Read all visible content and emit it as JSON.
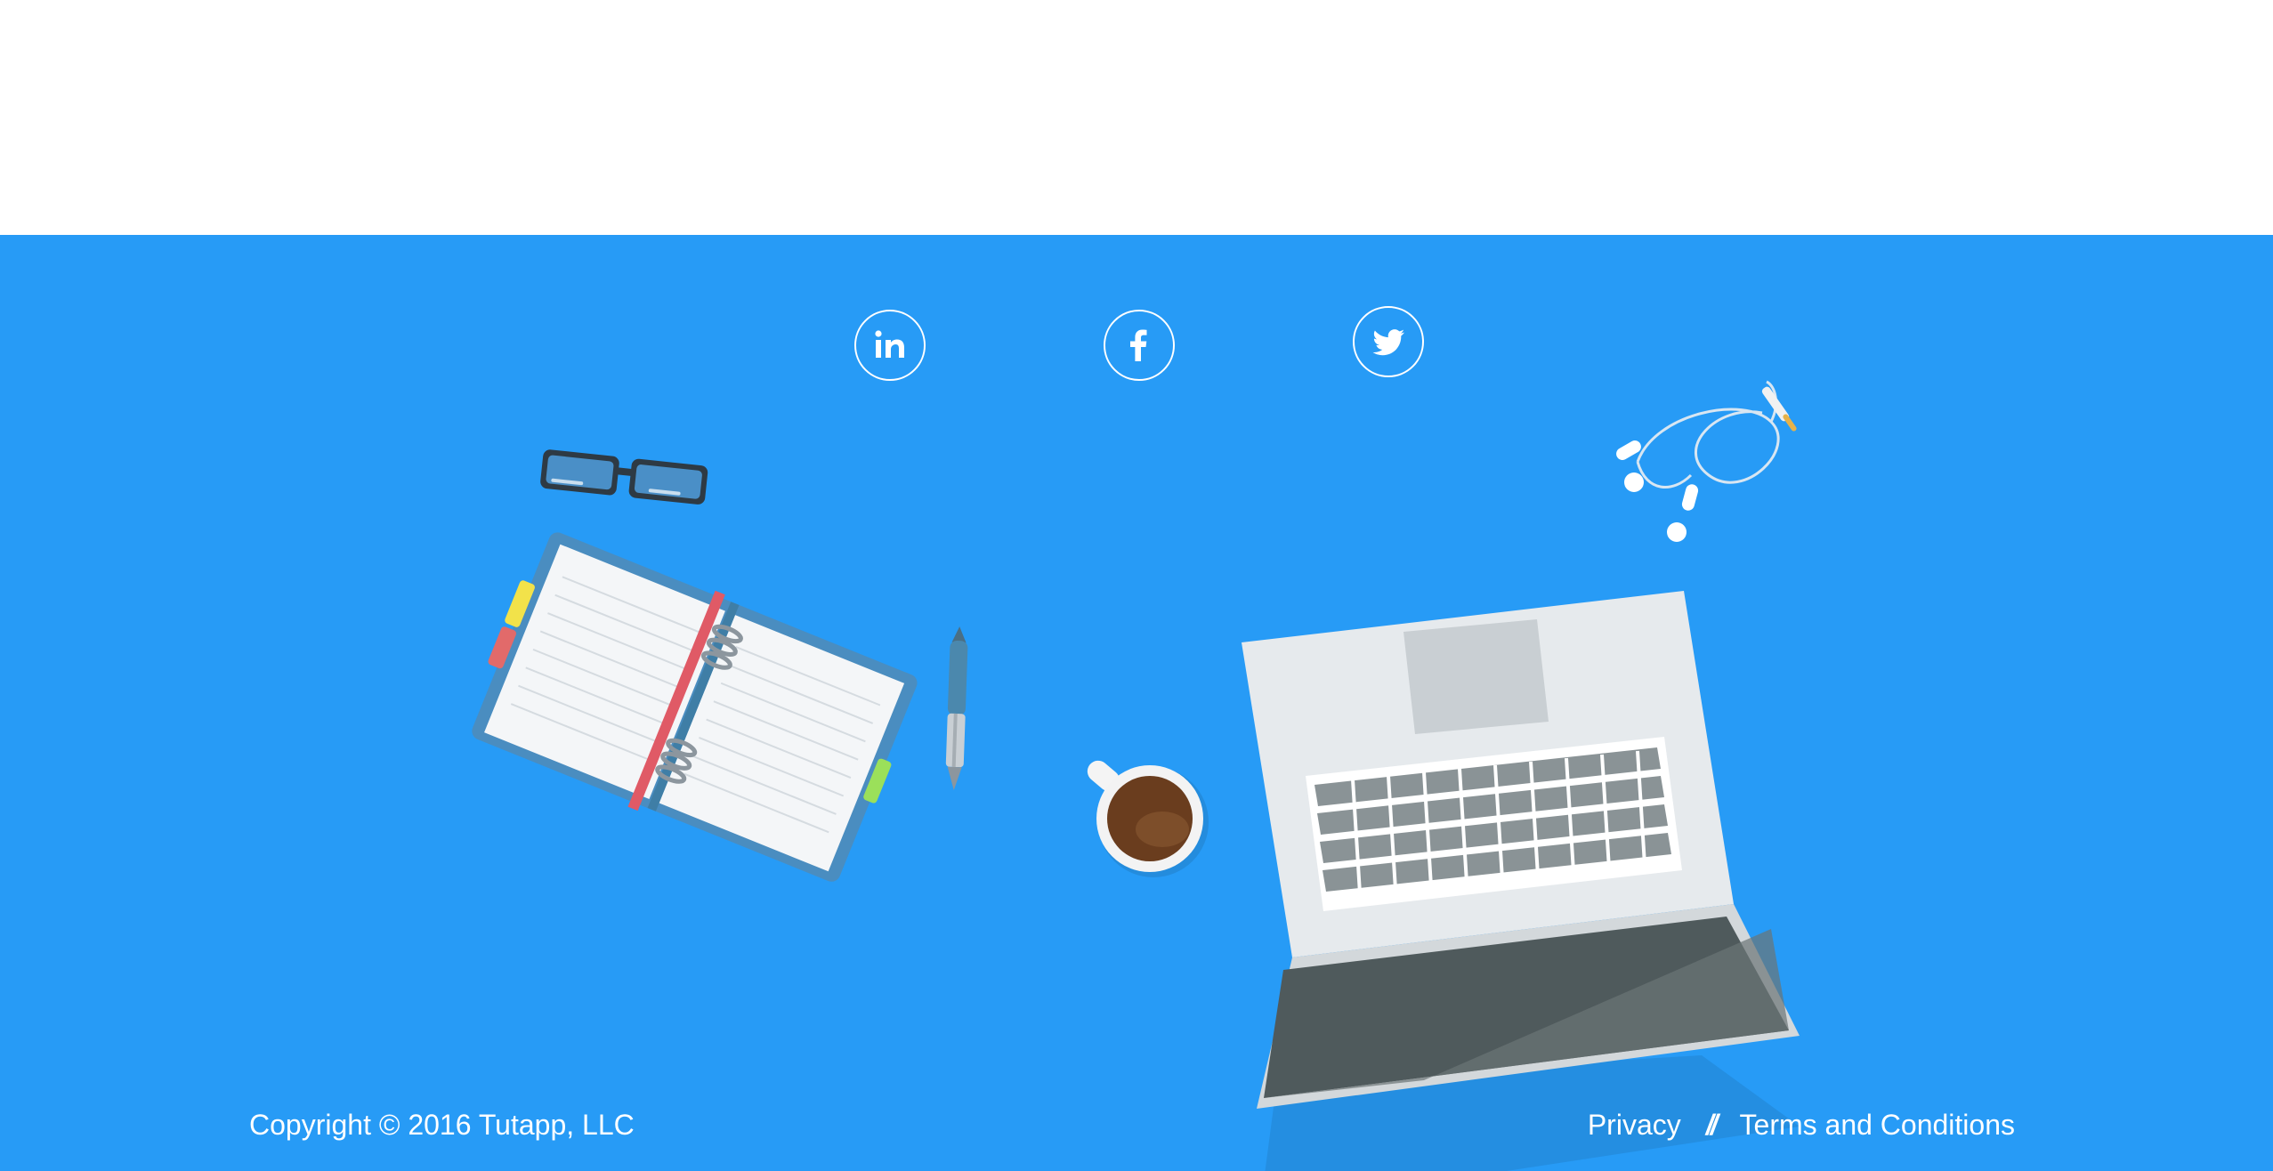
{
  "footer": {
    "background_color": "#279bf6",
    "copyright": "Copyright © 2016 Tutapp, LLC",
    "links": {
      "privacy": "Privacy",
      "separator": "//",
      "terms": "Terms and Conditions"
    },
    "social": [
      {
        "name": "linkedin-icon",
        "label": "in"
      },
      {
        "name": "facebook-icon",
        "label": "f"
      },
      {
        "name": "twitter-icon",
        "label": "twitter"
      }
    ]
  }
}
